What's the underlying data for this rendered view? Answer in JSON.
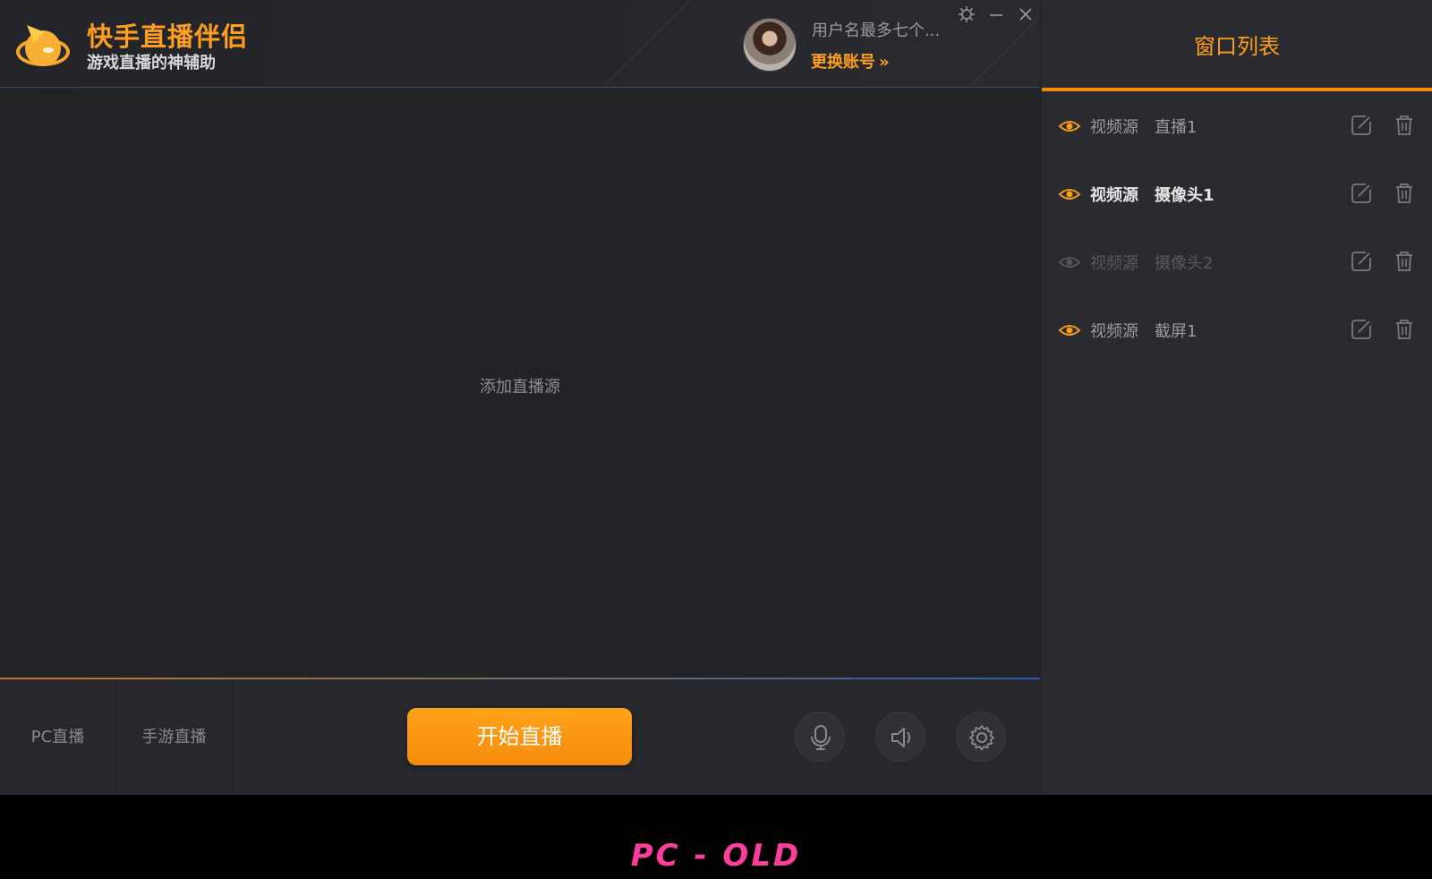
{
  "colors": {
    "accent": "#ff9e1b",
    "caption": "#ff3d9e"
  },
  "header": {
    "title": "快手直播伴侣",
    "subtitle": "游戏直播的神辅助",
    "username": "用户名最多七个...",
    "switch_account": "更换账号",
    "switch_chevron": "»"
  },
  "preview": {
    "add_source": "添加直播源"
  },
  "bottom": {
    "tabs": [
      {
        "label": "PC直播"
      },
      {
        "label": "手游直播"
      }
    ],
    "start_button": "开始直播"
  },
  "sidebar": {
    "title": "窗口列表",
    "sources": [
      {
        "type": "视频源",
        "name": "直播1",
        "state": "visible"
      },
      {
        "type": "视频源",
        "name": "摄像头1",
        "state": "selected"
      },
      {
        "type": "视频源",
        "name": "摄像头2",
        "state": "hidden"
      },
      {
        "type": "视频源",
        "name": "截屏1",
        "state": "visible"
      }
    ]
  },
  "caption": "PC - OLD",
  "icons": [
    "app-logo-icon",
    "settings-small-icon",
    "minimize-icon",
    "close-icon",
    "eye-icon",
    "edit-icon",
    "trash-icon",
    "microphone-icon",
    "speaker-icon",
    "gear-icon"
  ]
}
